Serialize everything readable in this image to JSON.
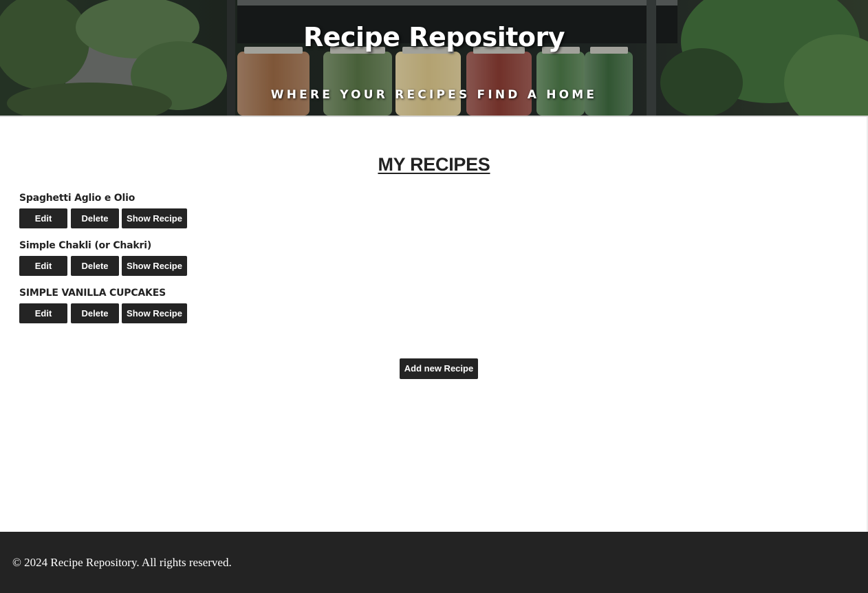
{
  "header": {
    "title": "Recipe Repository",
    "subtitle": "WHERE YOUR RECIPES FIND A HOME"
  },
  "main": {
    "heading": "MY RECIPES",
    "recipes": [
      {
        "name": "Spaghetti Aglio e Olio",
        "edit_label": "Edit",
        "delete_label": "Delete",
        "show_label": "Show Recipe"
      },
      {
        "name": "Simple Chakli (or Chakri)",
        "edit_label": "Edit",
        "delete_label": "Delete",
        "show_label": "Show Recipe"
      },
      {
        "name": "SIMPLE VANILLA CUPCAKES",
        "edit_label": "Edit",
        "delete_label": "Delete",
        "show_label": "Show Recipe"
      }
    ],
    "add_button_label": "Add new Recipe"
  },
  "footer": {
    "text": "© 2024 Recipe Repository. All rights reserved."
  },
  "colors": {
    "button_bg": "#242424",
    "footer_bg": "#232323",
    "heading_text": "#222222"
  }
}
